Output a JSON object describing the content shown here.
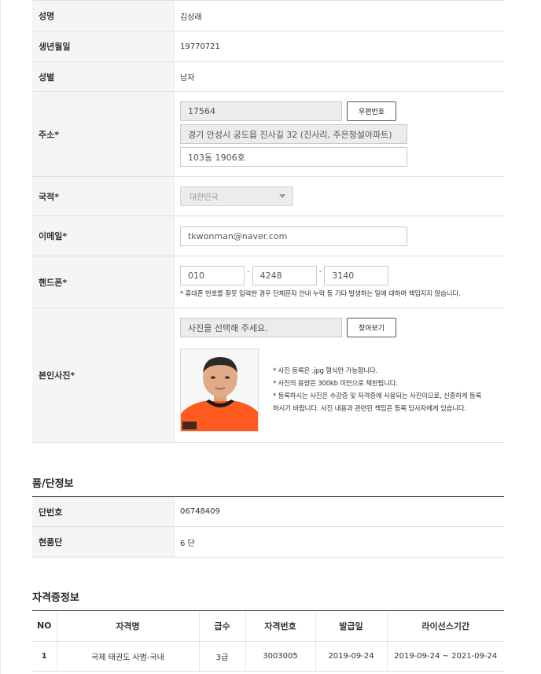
{
  "personal": {
    "name_label": "성명",
    "name_value": "김상래",
    "birth_label": "생년월일",
    "birth_value": "19770721",
    "gender_label": "성별",
    "gender_value": "남자",
    "address_label": "주소*",
    "postal_code": "17564",
    "postal_button": "우편번호",
    "address_line1": "경기 안성시 공도읍 진사길 32 (진사리, 주은청설아파트)",
    "address_line2": "103동 1906호",
    "nationality_label": "국적*",
    "nationality_value": "대한민국",
    "email_label": "이메일*",
    "email_value": "tkwonman@naver.com",
    "phone_label": "핸드폰*",
    "phone1": "010",
    "phone2": "4248",
    "phone3": "3140",
    "phone_dash": "-",
    "phone_note": "* 휴대폰 번호를 잘못 입력한 경우 단체문자 안내 누락 등 기타 발생하는 일에 대하여 책임지지 않습니다.",
    "photo_label": "본인사진*",
    "photo_placeholder": "사진을 선택해 주세요.",
    "photo_button": "찾아보기",
    "photo_note1": "* 사진 등록은 .jpg 형식만 가능합니다.",
    "photo_note2": "* 사진의 용량은 300kb 미만으로 제한됩니다.",
    "photo_note3": "* 등록하시는 사진은 수강증 및 자격증에 사용되는 사진이므로, 신중하게 등록",
    "photo_note4": "하시기 바랍니다. 사진 내용과 관련된 책임은 등록 당사자에게 있습니다."
  },
  "poom": {
    "title": "품/단정보",
    "dan_number_label": "단번호",
    "dan_number_value": "06748409",
    "current_label": "현품단",
    "current_value": "6 단"
  },
  "certs": {
    "title": "자격증정보",
    "headers": [
      "NO",
      "자격명",
      "급수",
      "자격번호",
      "발급일",
      "라이선스기간"
    ],
    "rows": [
      [
        "1",
        "국제 태권도 사범-국내",
        "3급",
        "3003005",
        "2019-09-24",
        "2019-09-24 ~ 2021-09-24"
      ]
    ]
  },
  "colors": {
    "label_bg": "#f5f5f5",
    "border": "#e0e0e0",
    "photo_shirt": "#ff5a1f"
  }
}
